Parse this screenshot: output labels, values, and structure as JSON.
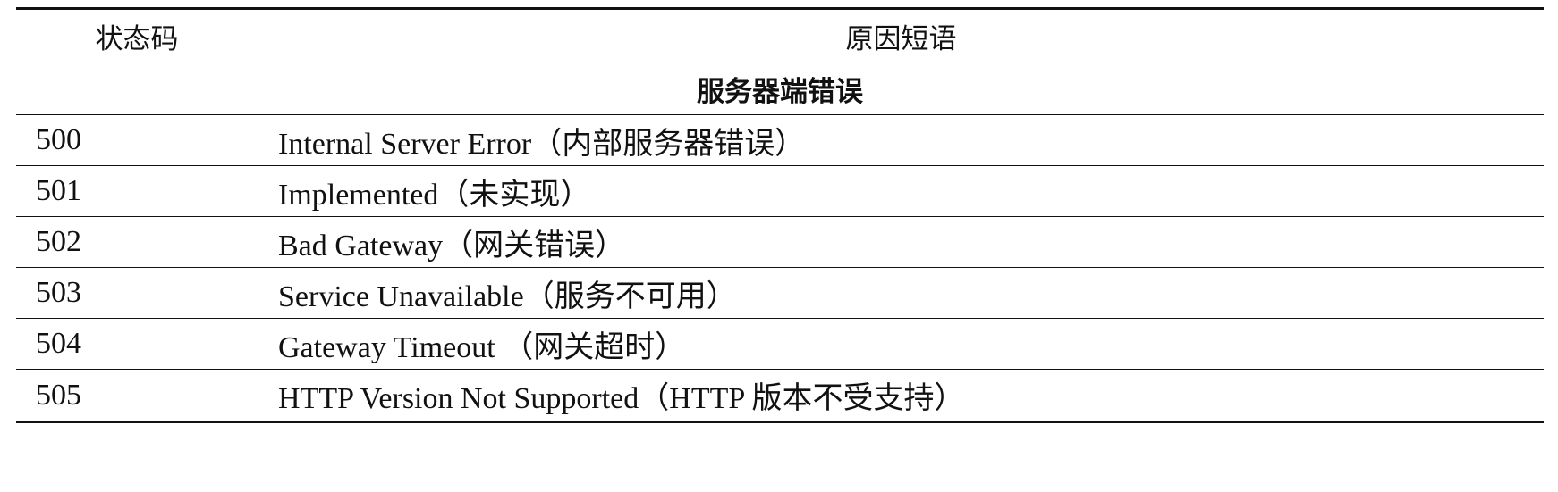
{
  "table": {
    "headers": {
      "code": "状态码",
      "phrase": "原因短语"
    },
    "section_title": "服务器端错误",
    "rows": [
      {
        "code": "500",
        "phrase": "Internal Server Error（内部服务器错误）"
      },
      {
        "code": "501",
        "phrase": "Implemented（未实现）"
      },
      {
        "code": "502",
        "phrase": "Bad Gateway（网关错误）"
      },
      {
        "code": "503",
        "phrase": "Service Unavailable（服务不可用）"
      },
      {
        "code": "504",
        "phrase": "Gateway Timeout （网关超时）"
      },
      {
        "code": "505",
        "phrase": "HTTP Version Not Supported（HTTP 版本不受支持）"
      }
    ]
  }
}
